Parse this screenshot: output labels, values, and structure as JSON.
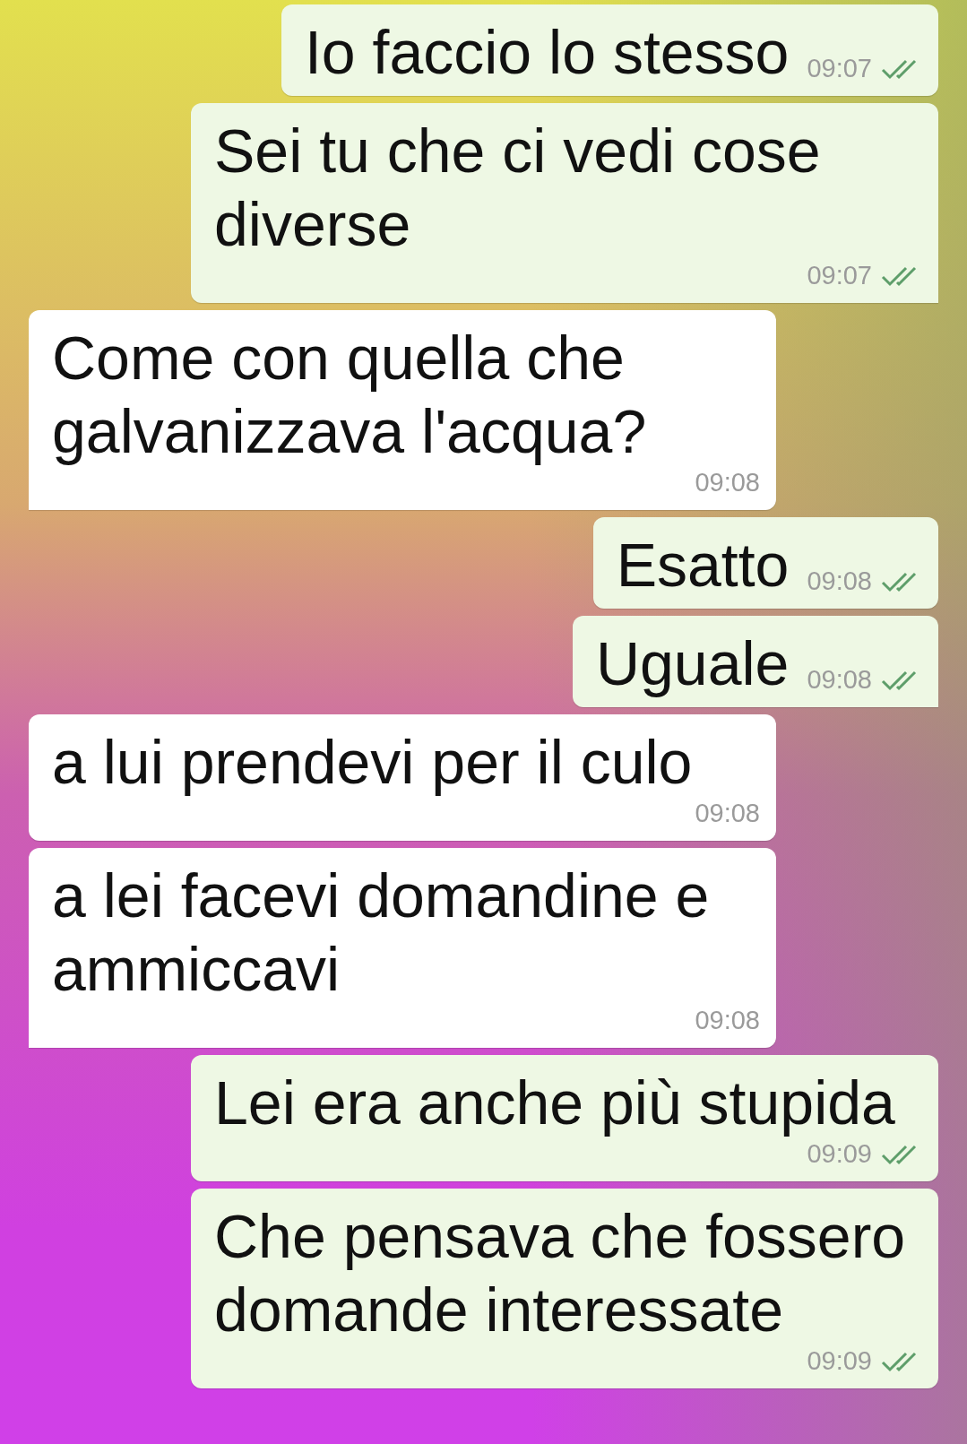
{
  "messages": [
    {
      "kind": "sent",
      "text": "Io faccio lo stesso",
      "time": "09:07",
      "tail": false,
      "read": true
    },
    {
      "kind": "sent",
      "text": "Sei tu che ci vedi cose diverse",
      "time": "09:07",
      "tail": true,
      "read": true
    },
    {
      "kind": "received",
      "text": "Come con quella che galvanizzava l'acqua?",
      "time": "09:08",
      "tail": true
    },
    {
      "kind": "sent",
      "text": "Esatto",
      "time": "09:08",
      "tail": false,
      "read": true
    },
    {
      "kind": "sent",
      "text": "Uguale",
      "time": "09:08",
      "tail": true,
      "read": true
    },
    {
      "kind": "received",
      "text": "a lui prendevi per il culo",
      "time": "09:08",
      "tail": false
    },
    {
      "kind": "received",
      "text": "a lei facevi domandine e ammiccavi",
      "time": "09:08",
      "tail": true
    },
    {
      "kind": "sent",
      "text": "Lei era anche più stupida",
      "time": "09:09",
      "tail": false,
      "read": true
    },
    {
      "kind": "sent",
      "text": "Che pensava che fossero domande interessate",
      "time": "09:09",
      "tail": false,
      "read": true
    }
  ]
}
